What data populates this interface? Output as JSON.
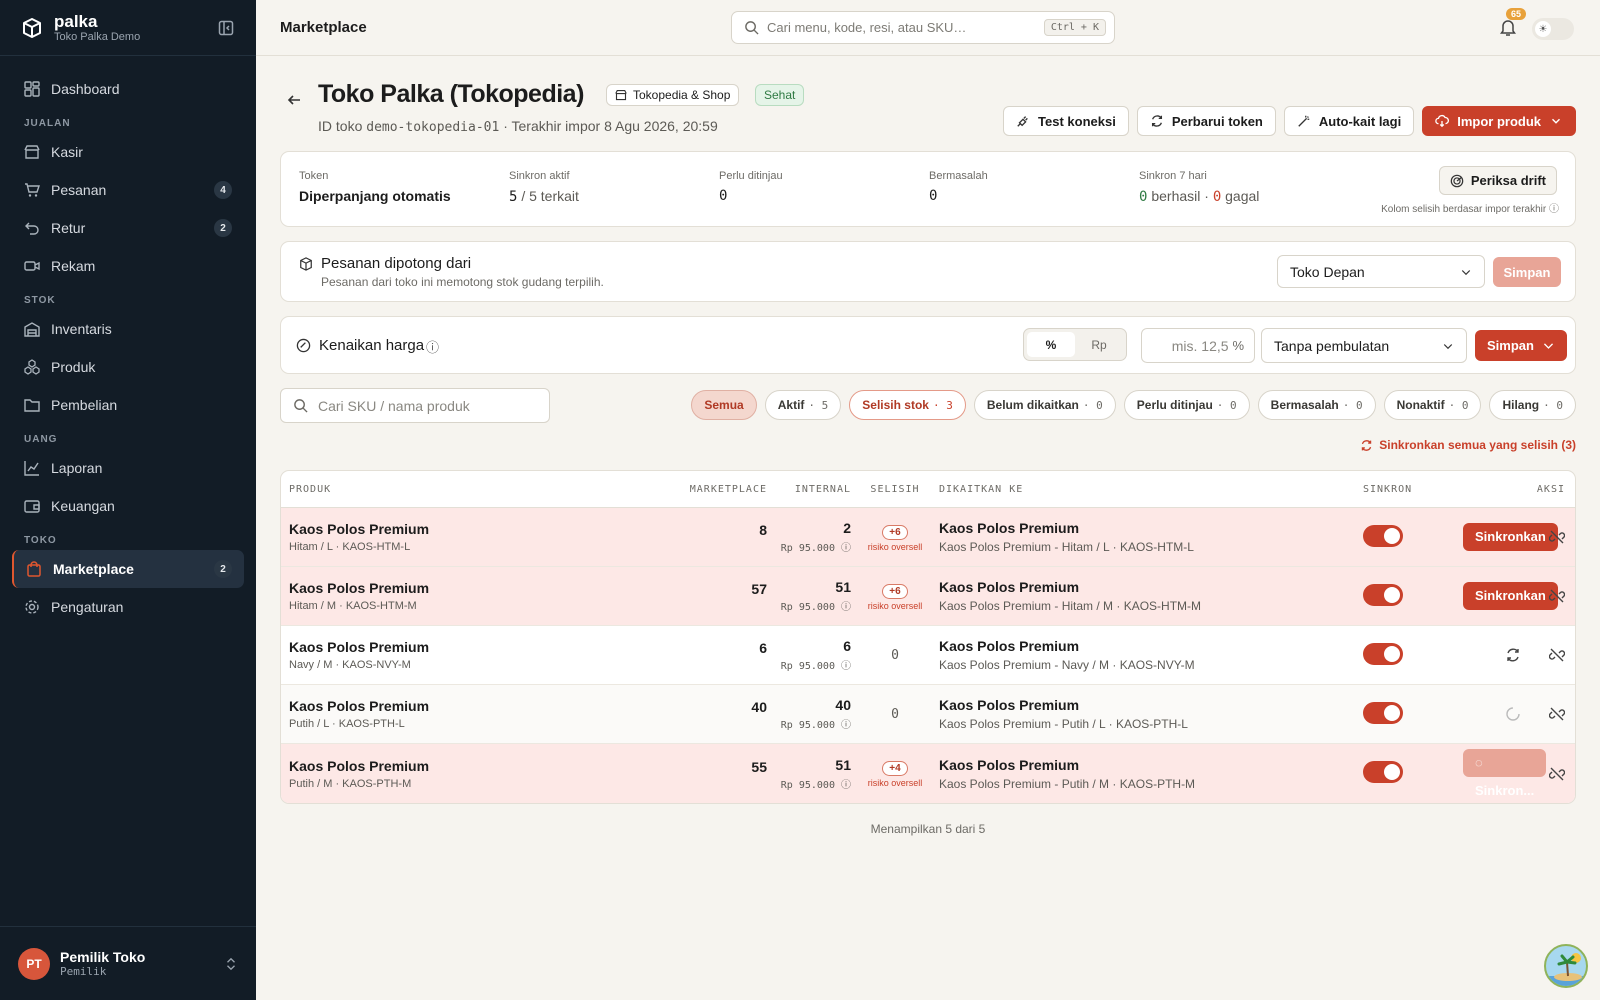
{
  "brand": {
    "name": "palka",
    "store": "Toko Palka Demo"
  },
  "nav": {
    "dashboard": "Dashboard",
    "sec_jualan": "JUALAN",
    "kasir": "Kasir",
    "pesanan": "Pesanan",
    "pesanan_badge": "4",
    "retur": "Retur",
    "retur_badge": "2",
    "rekam": "Rekam",
    "sec_stok": "STOK",
    "inventaris": "Inventaris",
    "produk": "Produk",
    "pembelian": "Pembelian",
    "sec_uang": "UANG",
    "laporan": "Laporan",
    "keuangan": "Keuangan",
    "sec_toko": "TOKO",
    "marketplace": "Marketplace",
    "marketplace_badge": "2",
    "pengaturan": "Pengaturan"
  },
  "user": {
    "initials": "PT",
    "name": "Pemilik Toko",
    "role": "Pemilik"
  },
  "topbar": {
    "title": "Marketplace",
    "search_placeholder": "Cari menu, kode, resi, atau SKU…",
    "shortcut": "Ctrl + K",
    "notif_count": "65"
  },
  "header": {
    "title": "Toko Palka (Tokopedia)",
    "channel_chip": "Tokopedia & Shop",
    "health": "Sehat",
    "id_prefix": "ID toko",
    "store_id": "demo-tokopedia-01",
    "last_import": "· Terakhir impor 8 Agu 2026, 20:59",
    "btn_test": "Test koneksi",
    "btn_token": "Perbarui token",
    "btn_autolink": "Auto-kait lagi",
    "btn_import": "Impor produk"
  },
  "stats": {
    "token_label": "Token",
    "token_value": "Diperpanjang otomatis",
    "sync_label": "Sinkron aktif",
    "sync_value": "5",
    "sync_total": "/ 5 terkait",
    "review_label": "Perlu ditinjau",
    "review_value": "0",
    "problem_label": "Bermasalah",
    "problem_value": "0",
    "week_label": "Sinkron 7 hari",
    "week_ok": "0",
    "week_ok_label": "berhasil ·",
    "week_fail": "0",
    "week_fail_label": "gagal",
    "drift_btn": "Periksa drift",
    "drift_note": "Kolom selisih berdasar impor terakhir"
  },
  "cut": {
    "title": "Pesanan dipotong dari",
    "desc": "Pesanan dari toko ini memotong stok gudang terpilih.",
    "warehouse": "Toko Depan",
    "save": "Simpan"
  },
  "price": {
    "title": "Kenaikan harga",
    "seg_pct": "%",
    "seg_rp": "Rp",
    "input_placeholder": "mis. 12,5",
    "unit": "%",
    "rounding": "Tanpa pembulatan",
    "save": "Simpan"
  },
  "filter": {
    "search_placeholder": "Cari SKU / nama produk",
    "pills": [
      {
        "label": "Semua",
        "count": ""
      },
      {
        "label": "Aktif",
        "count": "· 5"
      },
      {
        "label": "Selisih stok",
        "count": "· 3"
      },
      {
        "label": "Belum dikaitkan",
        "count": "· 0"
      },
      {
        "label": "Perlu ditinjau",
        "count": "· 0"
      },
      {
        "label": "Bermasalah",
        "count": "· 0"
      },
      {
        "label": "Nonaktif",
        "count": "· 0"
      },
      {
        "label": "Hilang",
        "count": "· 0"
      }
    ],
    "sync_all": "Sinkronkan semua yang selisih (3)"
  },
  "table": {
    "headers": {
      "produk": "PRODUK",
      "marketplace": "MARKETPLACE",
      "internal": "INTERNAL",
      "selisih": "SELISIH",
      "linked": "DIKAITKAN KE",
      "sinkron": "SINKRON",
      "aksi": "AKSI"
    },
    "rows": [
      {
        "name": "Kaos Polos Premium",
        "variant": "Hitam / L · KAOS-HTM-L",
        "mp": "8",
        "internal": "2",
        "price": "Rp 95.000",
        "diff": "+6",
        "risk": "risiko oversell",
        "linked": "Kaos Polos Premium",
        "linked_sub": "Kaos Polos Premium - Hitam / L · KAOS-HTM-L",
        "action": "Sinkronkan"
      },
      {
        "name": "Kaos Polos Premium",
        "variant": "Hitam / M · KAOS-HTM-M",
        "mp": "57",
        "internal": "51",
        "price": "Rp 95.000",
        "diff": "+6",
        "risk": "risiko oversell",
        "linked": "Kaos Polos Premium",
        "linked_sub": "Kaos Polos Premium - Hitam / M · KAOS-HTM-M",
        "action": "Sinkronkan"
      },
      {
        "name": "Kaos Polos Premium",
        "variant": "Navy / M · KAOS-NVY-M",
        "mp": "6",
        "internal": "6",
        "price": "Rp 95.000",
        "diff": "0",
        "risk": "",
        "linked": "Kaos Polos Premium",
        "linked_sub": "Kaos Polos Premium - Navy / M · KAOS-NVY-M",
        "action": ""
      },
      {
        "name": "Kaos Polos Premium",
        "variant": "Putih / L · KAOS-PTH-L",
        "mp": "40",
        "internal": "40",
        "price": "Rp 95.000",
        "diff": "0",
        "risk": "",
        "linked": "Kaos Polos Premium",
        "linked_sub": "Kaos Polos Premium - Putih / L · KAOS-PTH-L",
        "action": ""
      },
      {
        "name": "Kaos Polos Premium",
        "variant": "Putih / M · KAOS-PTH-M",
        "mp": "55",
        "internal": "51",
        "price": "Rp 95.000",
        "diff": "+4",
        "risk": "risiko oversell",
        "linked": "Kaos Polos Premium",
        "linked_sub": "Kaos Polos Premium - Putih / M · KAOS-PTH-M",
        "action": "Sinkron..."
      }
    ],
    "footer": "Menampilkan 5 dari 5"
  }
}
